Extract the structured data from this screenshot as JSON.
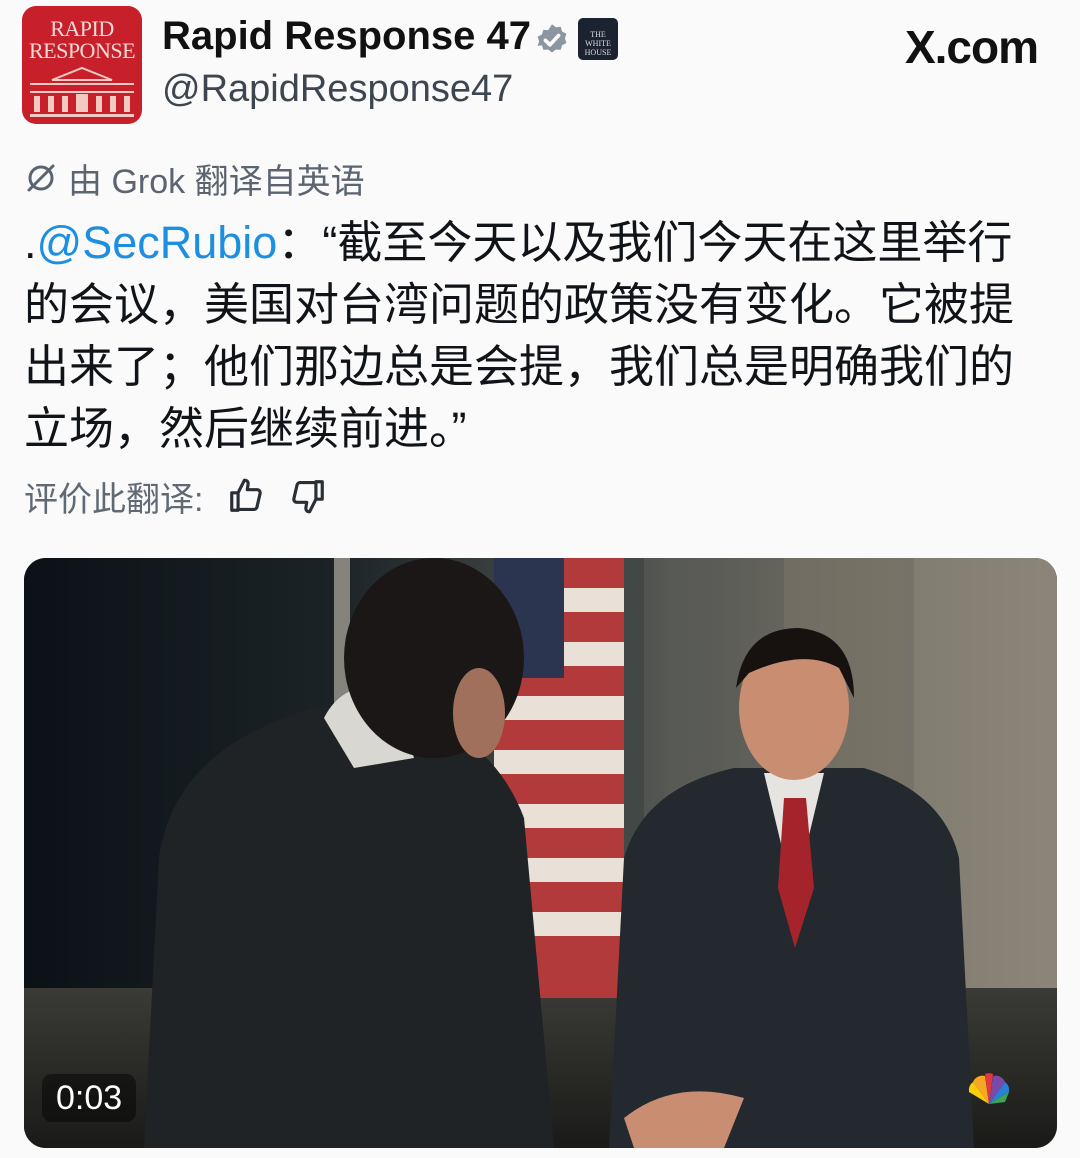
{
  "header": {
    "avatar_text": "RAPID RESPONSE",
    "display_name": "Rapid Response 47",
    "handle": "@RapidResponse47",
    "affiliation_badge_text": "THE WHITE HOUSE",
    "site_label": "X.com"
  },
  "translation": {
    "note": "由 Grok 翻译自英语",
    "rate_label": "评价此翻译:"
  },
  "tweet": {
    "mention_prefix": ".",
    "mention": "@SecRubio",
    "text": "：“截至今天以及我们今天在这里举行的会议，美国对台湾问题的政策没有变化。它被提出来了；他们那边总是会提，我们总是明确我们的立场，然后继续前进。”"
  },
  "video": {
    "timestamp": "0:03"
  },
  "colors": {
    "mention": "#1d8fe0",
    "verified": "#8b96a0",
    "avatar_bg": "#c8202b"
  },
  "icons": [
    "verified-badge-icon",
    "grok-icon",
    "thumbs-up-icon",
    "thumbs-down-icon",
    "network-logo-icon"
  ]
}
